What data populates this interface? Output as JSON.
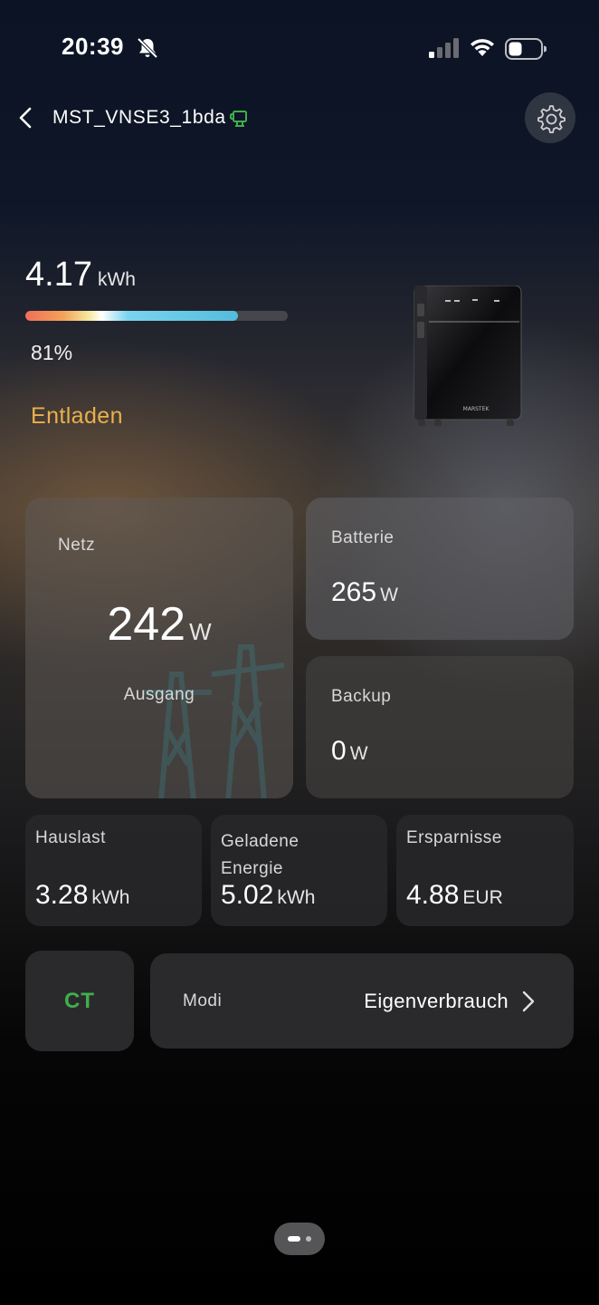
{
  "status_bar": {
    "time": "20:39",
    "icons": [
      "bell-slash-icon",
      "cellular-signal-icon",
      "wifi-icon",
      "battery-icon"
    ]
  },
  "header": {
    "device_name": "MST_VNSE3_1bda",
    "device_icon": "ct-meter-icon",
    "settings_icon": "gear-icon",
    "back_icon": "chevron-left-icon"
  },
  "energy": {
    "value": "4.17",
    "unit": "kWh",
    "percent_text": "81%",
    "level": 0.81,
    "status": "Entladen",
    "status_color": "#eab04c"
  },
  "cards": {
    "netz": {
      "label": "Netz",
      "value": "242",
      "unit": "W",
      "direction": "Ausgang"
    },
    "batterie": {
      "label": "Batterie",
      "value": "265",
      "unit": "W"
    },
    "backup": {
      "label": "Backup",
      "value": "0",
      "unit": "W"
    }
  },
  "stats": {
    "hauslast": {
      "label": "Hauslast",
      "value": "3.28",
      "unit": "kWh"
    },
    "geladene": {
      "label_line1": "Geladene",
      "label_line2": "Energie",
      "value": "5.02",
      "unit": "kWh"
    },
    "ersparnisse": {
      "label": "Ersparnisse",
      "value": "4.88",
      "unit": "EUR"
    }
  },
  "controls": {
    "ct_label": "CT",
    "ct_color": "#3fae4e",
    "modi_label": "Modi",
    "modi_value": "Eigenverbrauch"
  },
  "device_image": {
    "brand_text": "MARSTEK"
  }
}
